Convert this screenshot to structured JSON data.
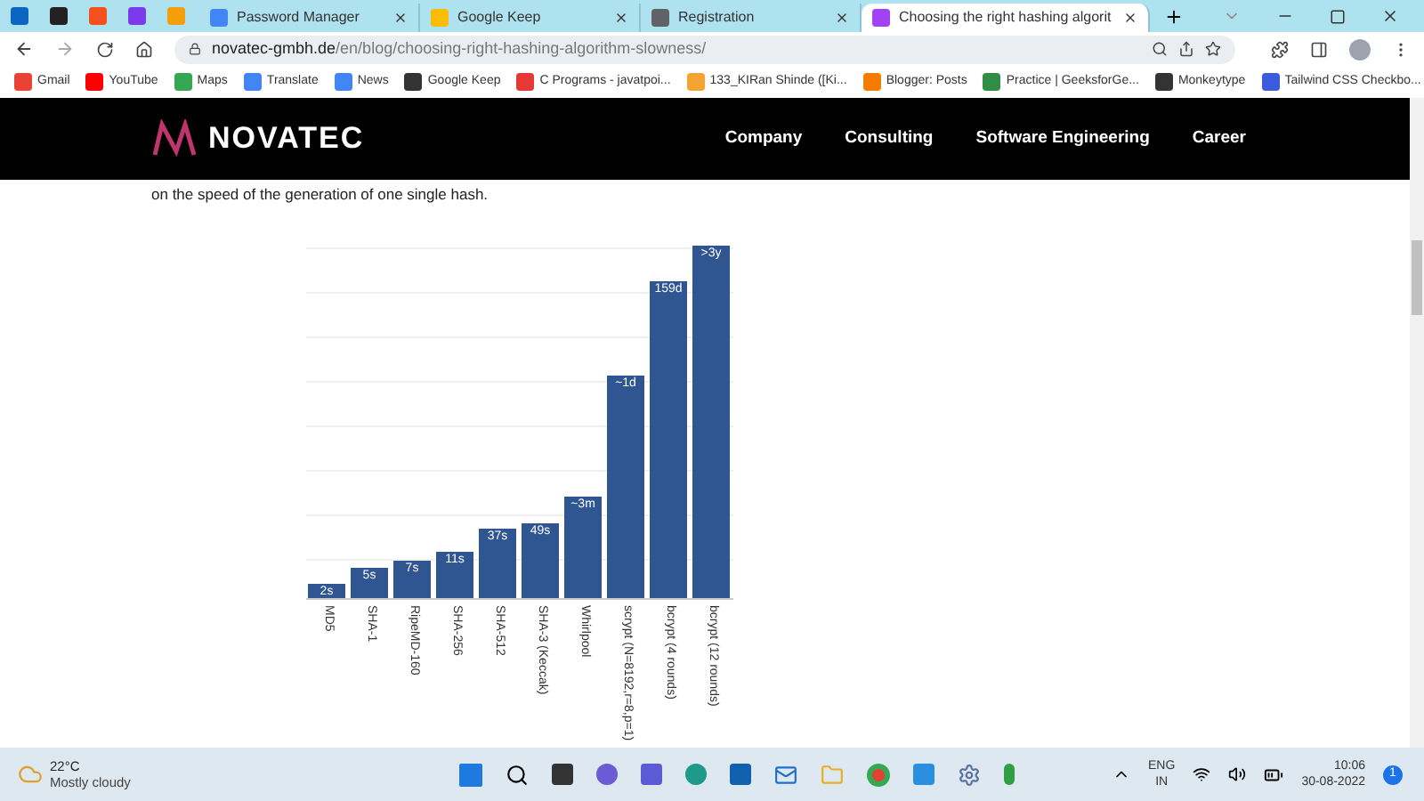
{
  "tabs": [
    {
      "title": "Password Manager",
      "selected": false
    },
    {
      "title": "Google Keep",
      "selected": false
    },
    {
      "title": "Registration",
      "selected": false
    },
    {
      "title": "Choosing the right hashing algorit",
      "selected": true
    }
  ],
  "address_bar": {
    "domain": "novatec-gmbh.de",
    "path": "/en/blog/choosing-right-hashing-algorithm-slowness/"
  },
  "bookmarks": [
    {
      "label": "Gmail"
    },
    {
      "label": "YouTube"
    },
    {
      "label": "Maps"
    },
    {
      "label": "Translate"
    },
    {
      "label": "News"
    },
    {
      "label": "Google Keep"
    },
    {
      "label": "C Programs - javatpoi..."
    },
    {
      "label": "133_KIRan Shinde ([Ki..."
    },
    {
      "label": "Blogger: Posts"
    },
    {
      "label": "Practice | GeeksforGe..."
    },
    {
      "label": "Monkeytype"
    },
    {
      "label": "Tailwind CSS Checkbo..."
    }
  ],
  "site_header": {
    "logo": "NOVATEC",
    "nav": [
      "Company",
      "Consulting",
      "Software Engineering",
      "Career"
    ]
  },
  "intro_text": "on the speed of the generation of one single hash.",
  "chart": {
    "bars": [
      {
        "category": "MD5",
        "value_label": "2s"
      },
      {
        "category": "SHA-1",
        "value_label": "5s"
      },
      {
        "category": "RipeMD-160",
        "value_label": "7s"
      },
      {
        "category": "SHA-256",
        "value_label": "11s"
      },
      {
        "category": "SHA-512",
        "value_label": "37s"
      },
      {
        "category": "SHA-3 (Keccak)",
        "value_label": "49s"
      },
      {
        "category": "Whirlpool",
        "value_label": "~3m"
      },
      {
        "category": "scrypt (N=8192,r=8,p=1)",
        "value_label": "~1d"
      },
      {
        "category": "bcrypt (4 rounds)",
        "value_label": "159d"
      },
      {
        "category": "bcrypt (12 rounds)",
        "value_label": ">3y"
      }
    ]
  },
  "taskbar": {
    "temperature": "22°C",
    "condition": "Mostly cloudy",
    "language": [
      "ENG",
      "IN"
    ],
    "time": "10:06",
    "date": "30-08-2022",
    "notifications": "1"
  }
}
